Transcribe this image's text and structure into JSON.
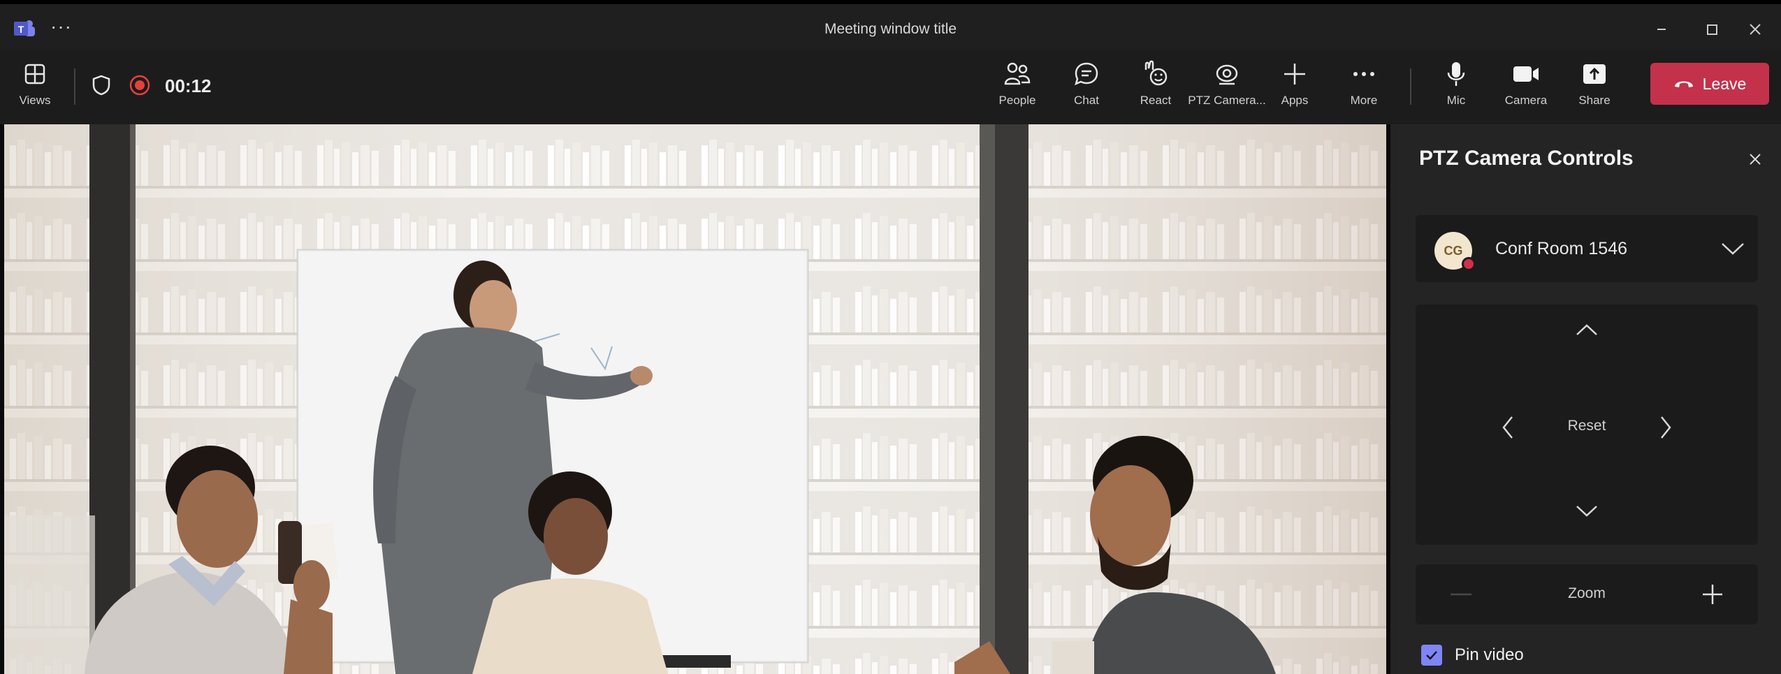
{
  "window": {
    "title": "Meeting window title"
  },
  "toolbar": {
    "views_label": "Views",
    "timer": "00:12",
    "people_label": "People",
    "chat_label": "Chat",
    "react_label": "React",
    "ptz_label": "PTZ Camera...",
    "apps_label": "Apps",
    "more_label": "More",
    "mic_label": "Mic",
    "camera_label": "Camera",
    "share_label": "Share",
    "leave_label": "Leave"
  },
  "panel": {
    "title": "PTZ Camera Controls",
    "room": {
      "avatar_initials": "CG",
      "name": "Conf Room 1546"
    },
    "pad": {
      "reset_label": "Reset"
    },
    "zoom_label": "Zoom",
    "pin_label": "Pin video",
    "pin_checked": true
  },
  "colors": {
    "leave": "#c4314b",
    "accent": "#7f85f5",
    "record": "#e5413d"
  }
}
